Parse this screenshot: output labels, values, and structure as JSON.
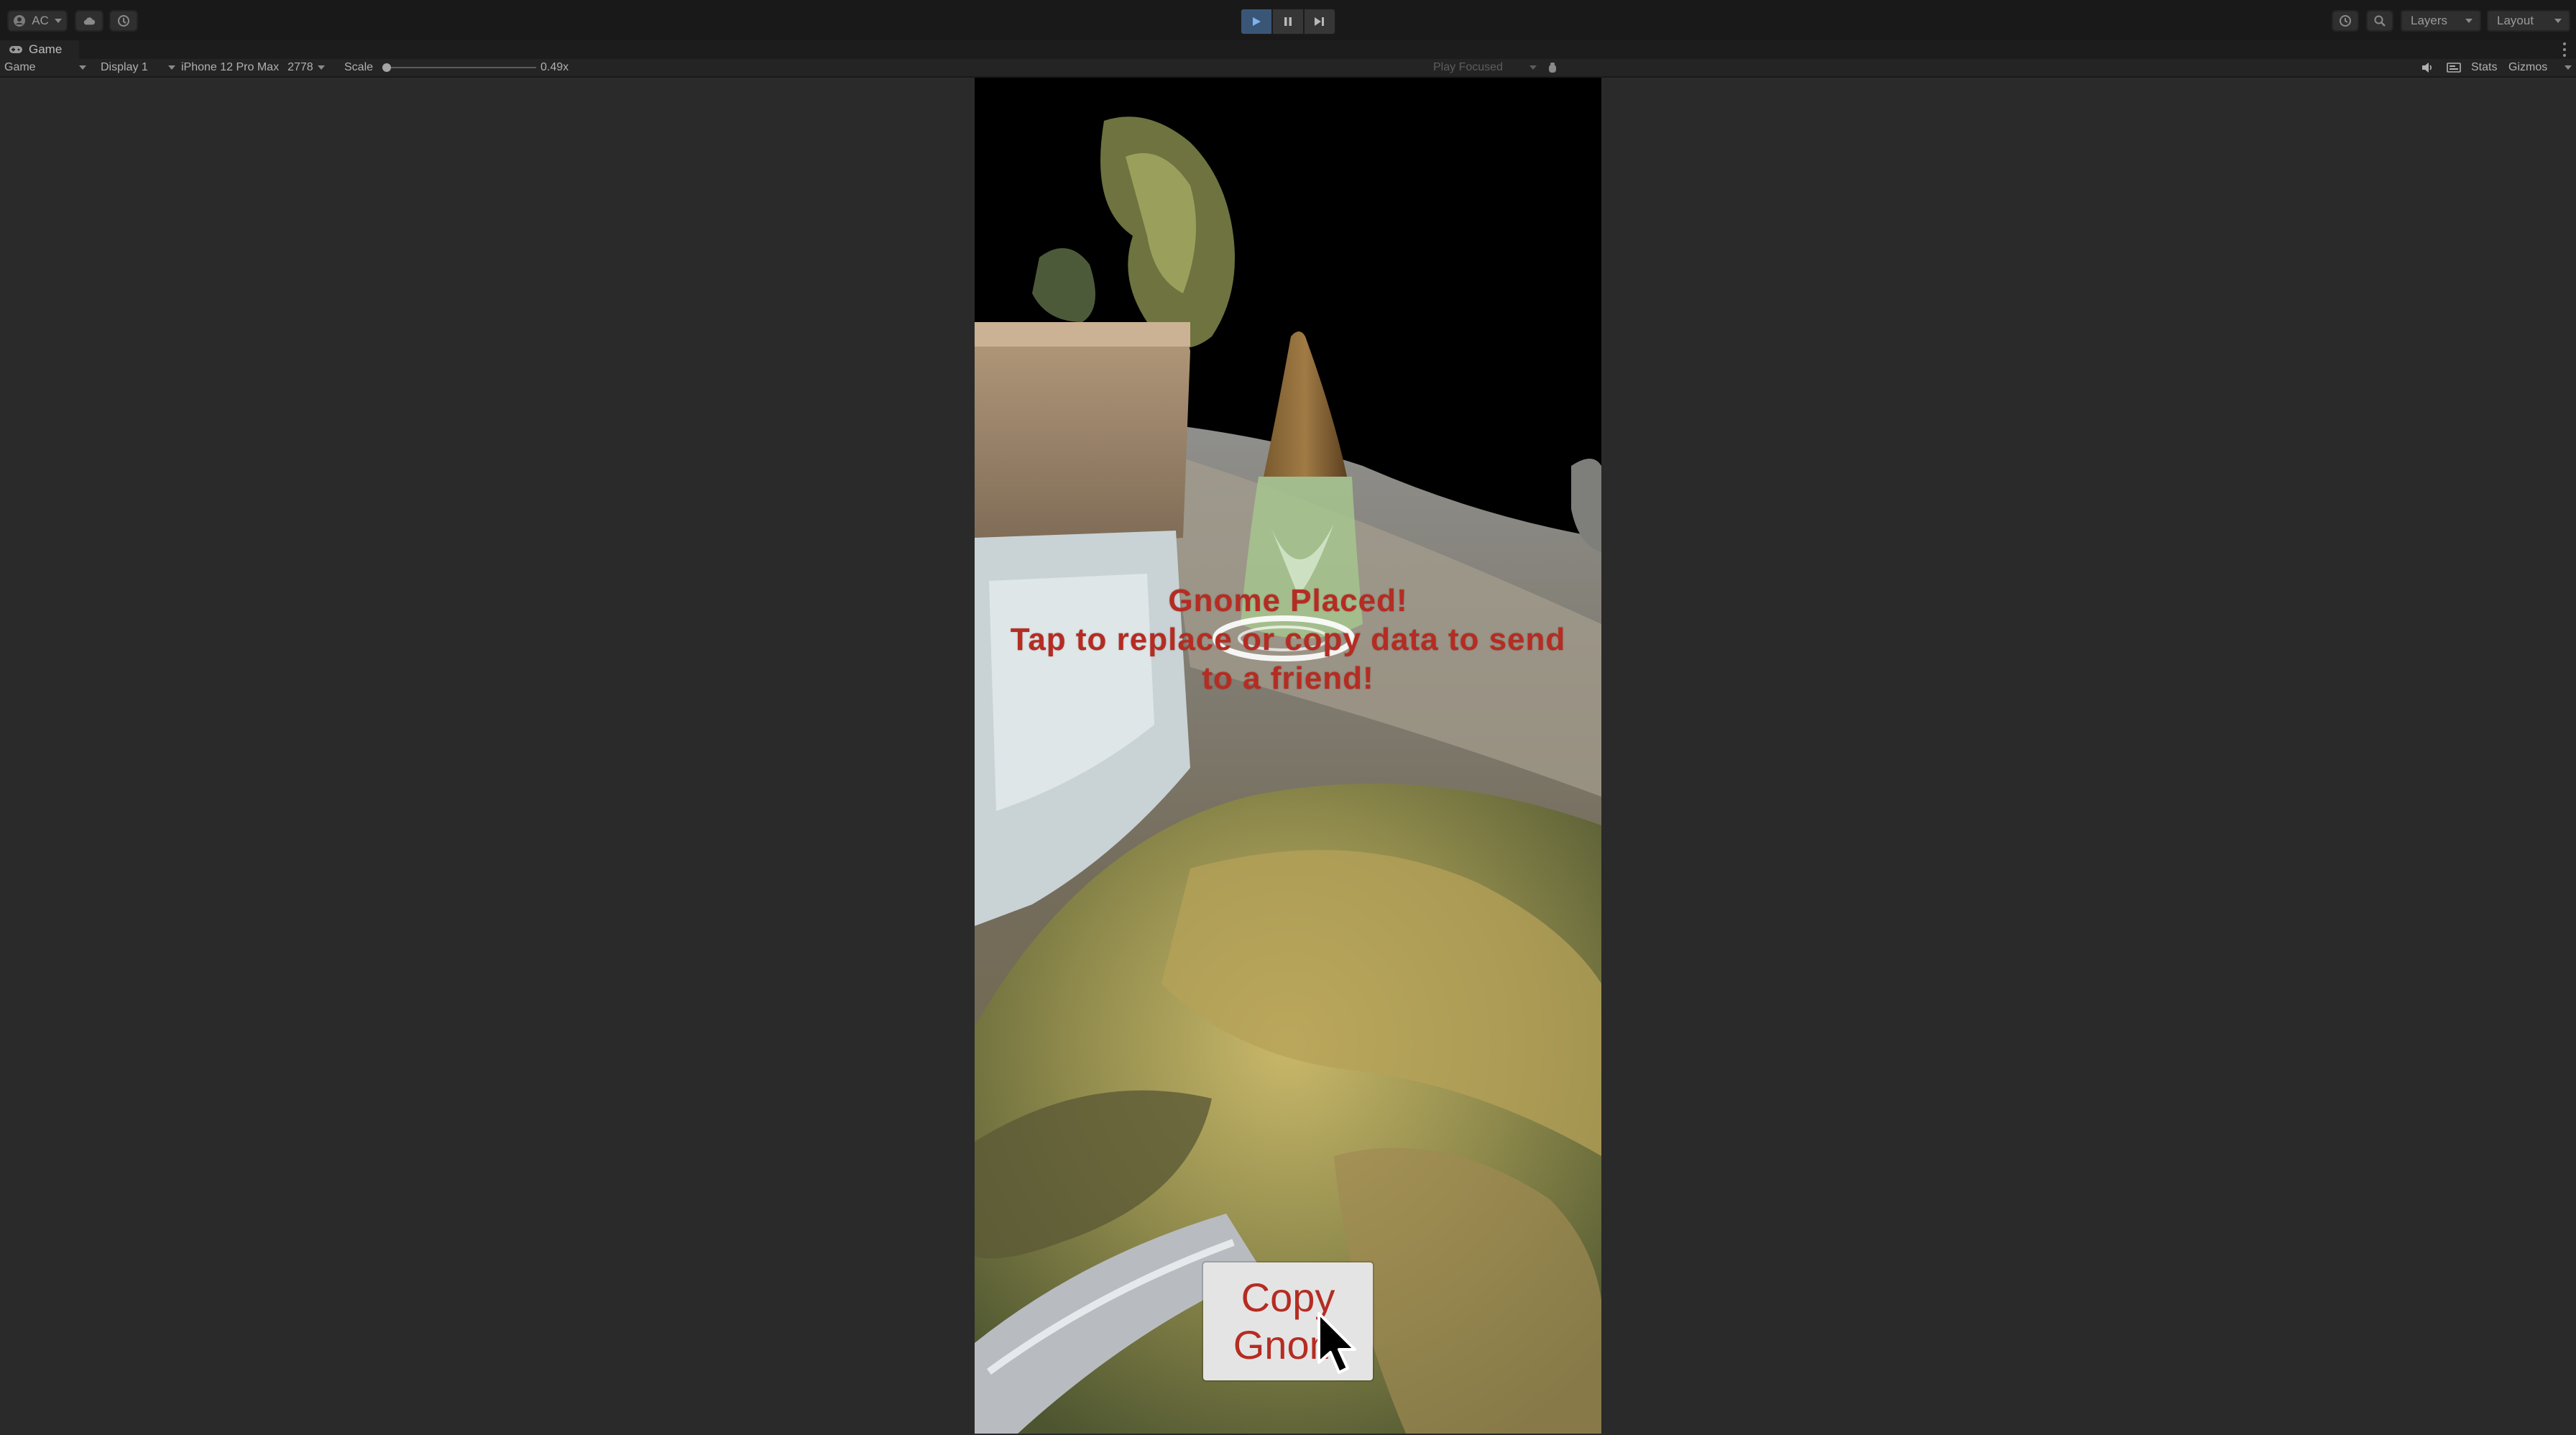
{
  "toolbar": {
    "account_label": "AC",
    "cloud_icon": "cloud-icon",
    "collab_icon": "collab-icon",
    "play_controls": [
      "play-icon",
      "pause-icon",
      "step-icon"
    ],
    "history_icon": "history-icon",
    "search_icon": "search-icon",
    "layers_label": "Layers",
    "layout_label": "Layout"
  },
  "tab": {
    "label": "Game",
    "icon": "gamepad-icon"
  },
  "gamebar": {
    "mode": "Game",
    "display": "Display 1",
    "device": "iPhone 12 Pro Max",
    "resolution": "2778",
    "scale_label": "Scale",
    "scale_value": "0.49x",
    "play_focus": "Play Focused",
    "stats_label": "Stats",
    "gizmos_label": "Gizmos"
  },
  "game": {
    "message_line1": "Gnome Placed!",
    "message_line2": "Tap to replace or copy data to send",
    "message_line3": "to a friend!",
    "copy_button_line1": "Copy",
    "copy_button_line2": "Gnom"
  },
  "colors": {
    "editor_bg": "#2a2a2a",
    "toolbar_bg": "#191919",
    "play_active": "#3a5677",
    "message_red": "#b52c22"
  }
}
